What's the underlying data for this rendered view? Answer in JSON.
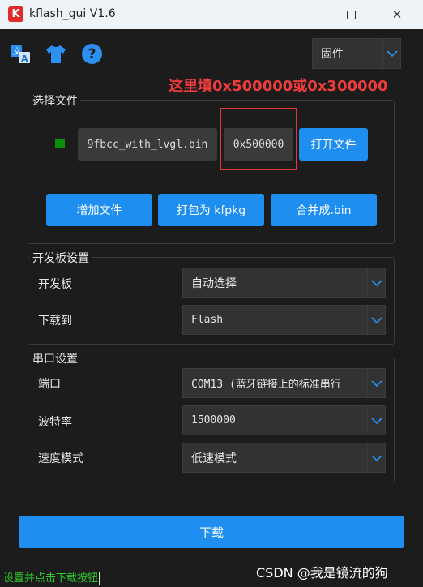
{
  "window": {
    "title": "kflash_gui V1.6",
    "app_icon_letter": "K"
  },
  "toolbar": {
    "mode_select": "固件"
  },
  "annotation": {
    "text": "这里填0x500000或0x300000"
  },
  "file_group": {
    "title": "选择文件",
    "file_name": "9fbcc_with_lvgl.bin",
    "address": "0x500000",
    "open_button": "打开文件",
    "add_button": "增加文件",
    "pack_button": "打包为 kfpkg",
    "merge_button": "合并成.bin"
  },
  "board_group": {
    "title": "开发板设置",
    "board_label": "开发板",
    "board_value": "自动选择",
    "target_label": "下载到",
    "target_value": "Flash"
  },
  "serial_group": {
    "title": "串口设置",
    "port_label": "端口",
    "port_value": "COM13 (蓝牙链接上的标准串行",
    "baud_label": "波特率",
    "baud_value": "1500000",
    "speed_label": "速度模式",
    "speed_value": "低速模式"
  },
  "download_button": "下载",
  "status_text": "设置并点击下载按钮",
  "watermark": "CSDN @我是镜流的狗",
  "colors": {
    "accent": "#1e8ef0",
    "annotation_red": "#ee3b3b",
    "status_green": "#2bd02b",
    "background": "#1c1c1c"
  }
}
